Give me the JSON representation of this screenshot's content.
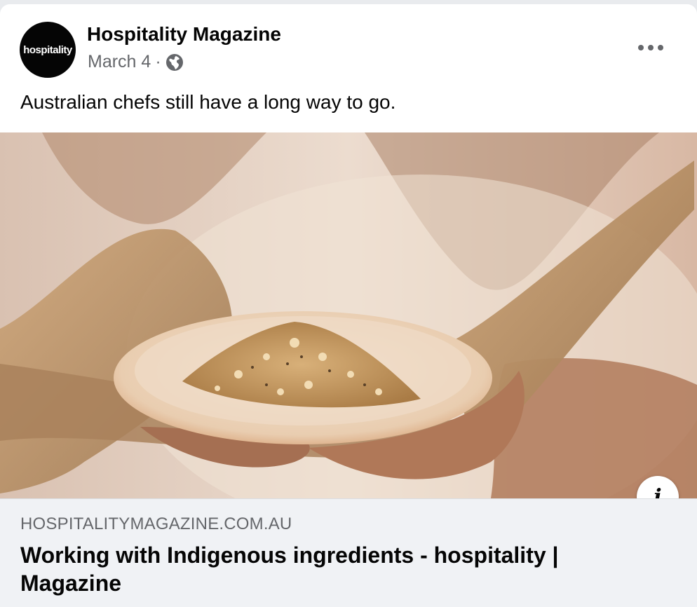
{
  "post": {
    "page_name": "Hospitality Magazine",
    "avatar_text": "hospitality",
    "date": "March 4",
    "separator": "·",
    "privacy_icon": "globe-icon",
    "more_icon": "more-horizontal-icon",
    "caption": "Australian chefs still have a long way to go."
  },
  "link_preview": {
    "domain": "HOSPITALITYMAGAZINE.COM.AU",
    "title": "Working with Indigenous ingredients - hospitality | Magazine",
    "info_label": "i"
  },
  "colors": {
    "text_primary": "#050505",
    "text_secondary": "#65676b",
    "link_bg": "#f0f2f5"
  }
}
